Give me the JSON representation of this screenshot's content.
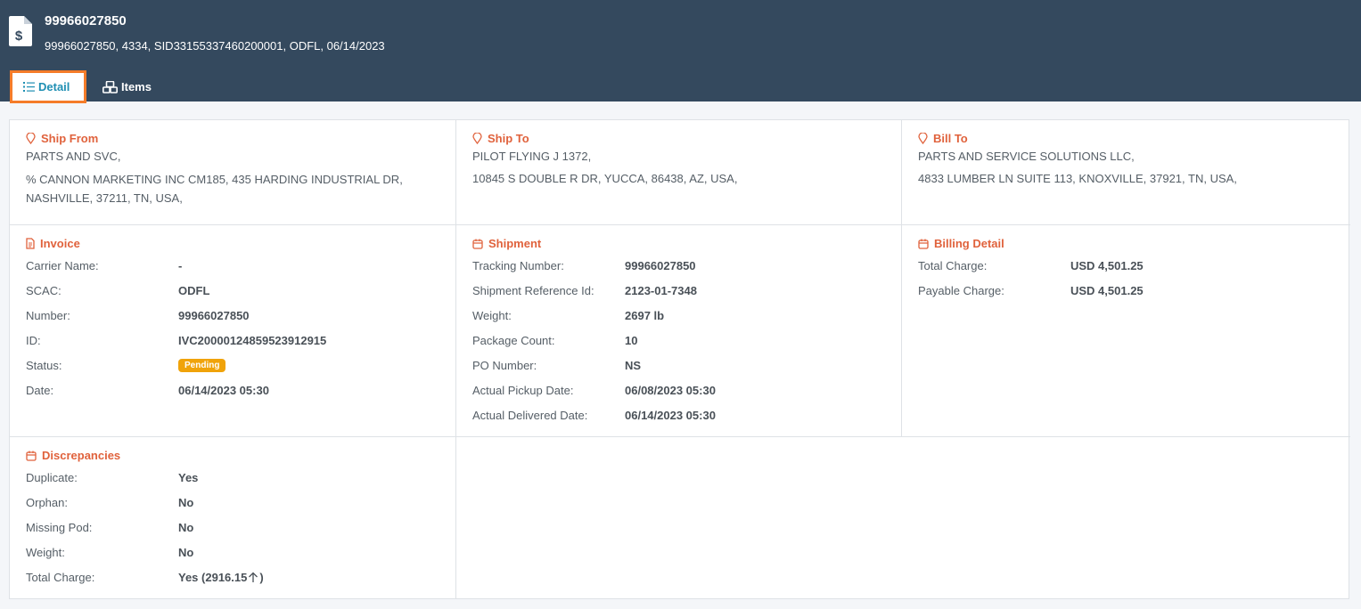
{
  "header": {
    "title": "99966027850",
    "subtitle": "99966027850, 4334, SID33155337460200001, ODFL, 06/14/2023",
    "icon": "invoice-dollar-icon"
  },
  "tabs": [
    {
      "label": "Detail",
      "icon": "list-icon",
      "active": true
    },
    {
      "label": "Items",
      "icon": "boxes-icon",
      "active": false
    }
  ],
  "ship_from": {
    "title": "Ship From",
    "name": "PARTS AND SVC,",
    "address": "% CANNON MARKETING INC CM185, 435 HARDING INDUSTRIAL DR, NASHVILLE, 37211, TN, USA,"
  },
  "ship_to": {
    "title": "Ship To",
    "name": "PILOT FLYING J 1372,",
    "address": "10845 S DOUBLE R DR, YUCCA, 86438, AZ, USA,"
  },
  "bill_to": {
    "title": "Bill To",
    "name": "PARTS AND SERVICE SOLUTIONS LLC,",
    "address": "4833 LUMBER LN SUITE 113, KNOXVILLE, 37921, TN, USA,"
  },
  "invoice": {
    "title": "Invoice",
    "rows": [
      {
        "label": "Carrier Name:",
        "value": "-"
      },
      {
        "label": "SCAC:",
        "value": "ODFL"
      },
      {
        "label": "Number:",
        "value": "99966027850"
      },
      {
        "label": "ID:",
        "value": "IVC20000124859523912915"
      },
      {
        "label": "Status:",
        "value": "Pending"
      },
      {
        "label": "Date:",
        "value": "06/14/2023 05:30"
      }
    ]
  },
  "shipment": {
    "title": "Shipment",
    "rows": [
      {
        "label": "Tracking Number:",
        "value": "99966027850"
      },
      {
        "label": "Shipment Reference Id:",
        "value": "2123-01-7348"
      },
      {
        "label": "Weight:",
        "value": "2697 lb"
      },
      {
        "label": "Package Count:",
        "value": "10"
      },
      {
        "label": "PO Number:",
        "value": "NS"
      },
      {
        "label": "Actual Pickup Date:",
        "value": "06/08/2023 05:30"
      },
      {
        "label": "Actual Delivered Date:",
        "value": "06/14/2023 05:30"
      }
    ]
  },
  "billing": {
    "title": "Billing Detail",
    "rows": [
      {
        "label": "Total Charge:",
        "value": "USD 4,501.25"
      },
      {
        "label": "Payable Charge:",
        "value": "USD 4,501.25"
      }
    ]
  },
  "discrepancies": {
    "title": "Discrepancies",
    "rows": [
      {
        "label": "Duplicate:",
        "value": "Yes"
      },
      {
        "label": "Orphan:",
        "value": "No"
      },
      {
        "label": "Missing Pod:",
        "value": "No"
      },
      {
        "label": "Weight:",
        "value": "No"
      },
      {
        "label": "Total Charge:",
        "value_prefix": "Yes (2916.15",
        "value_suffix": ")"
      }
    ]
  },
  "colors": {
    "header_bg": "#34495e",
    "accent": "#e0623c",
    "tab_active_border": "#f57c29",
    "tab_active_text": "#1f8fb3",
    "badge_pending": "#f0a30a"
  }
}
